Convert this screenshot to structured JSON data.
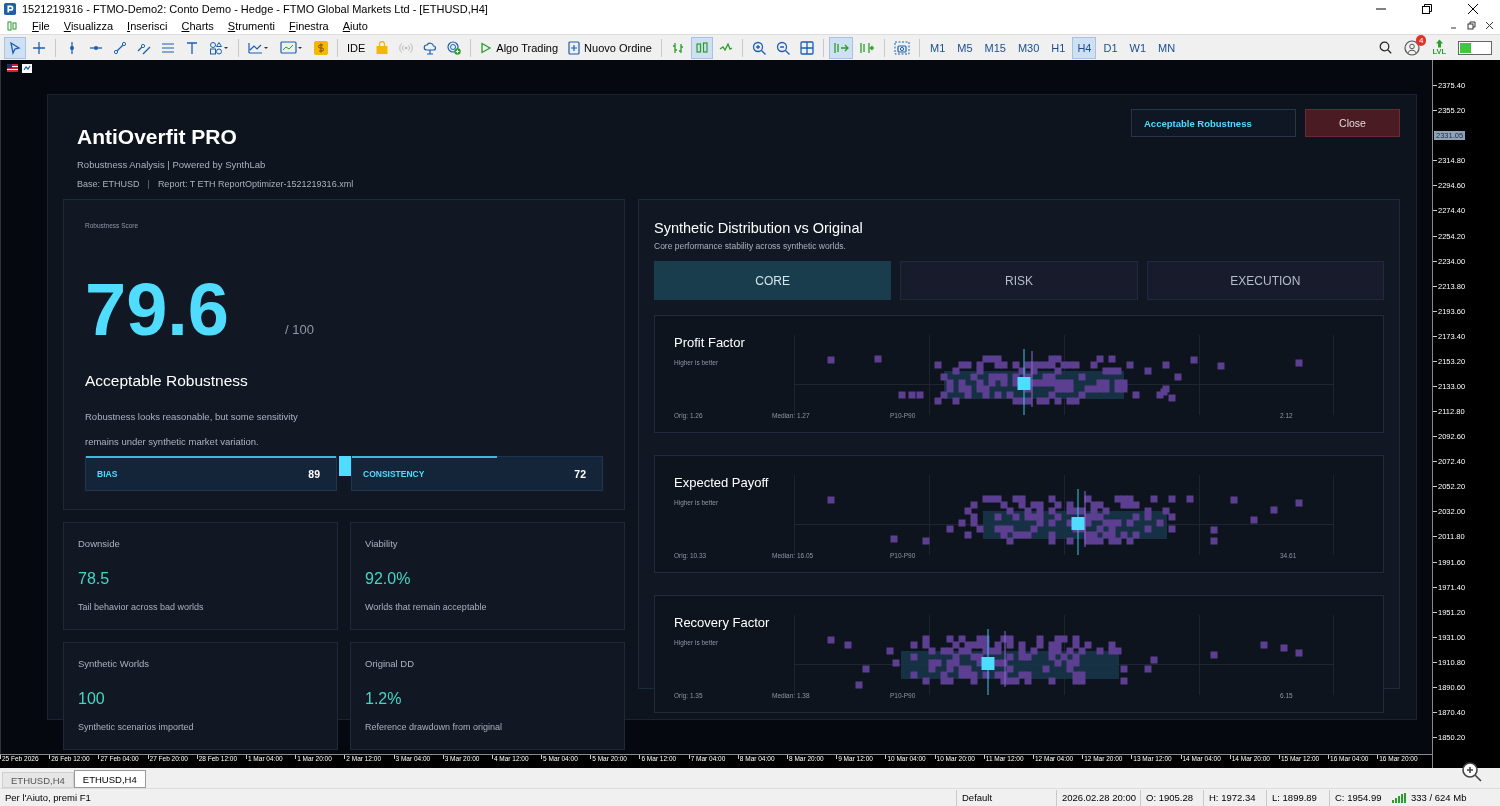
{
  "window": {
    "title": "1521219316 - FTMO-Demo2: Conto Demo - Hedge - FTMO Global Markets Ltd - [ETHUSD,H4]"
  },
  "menu": [
    "File",
    "Visualizza",
    "Inserisci",
    "Charts",
    "Strumenti",
    "Finestra",
    "Aiuto"
  ],
  "toolbar": {
    "groups": [
      [
        {
          "kind": "cursor",
          "selected": true
        },
        {
          "kind": "crosshair",
          "selected": false
        }
      ],
      [
        {
          "kind": "vline",
          "selected": false
        },
        {
          "kind": "hline",
          "selected": false
        },
        {
          "kind": "trend",
          "selected": false
        },
        {
          "kind": "channel",
          "selected": false
        },
        {
          "kind": "lines",
          "selected": false
        },
        {
          "kind": "text",
          "selected": false
        },
        {
          "kind": "shapes",
          "selected": false
        }
      ],
      [
        {
          "kind": "indicators",
          "selected": false
        },
        {
          "kind": "templates",
          "selected": false
        },
        {
          "kind": "market",
          "selected": false
        }
      ],
      [
        {
          "kind": "ide",
          "label": "IDE",
          "selected": false
        },
        {
          "kind": "bag",
          "selected": false
        },
        {
          "kind": "signal",
          "selected": false
        },
        {
          "kind": "cloud",
          "selected": false
        },
        {
          "kind": "vps",
          "selected": false
        }
      ],
      [
        {
          "kind": "algo",
          "label": "Algo Trading",
          "selected": false
        },
        {
          "kind": "order",
          "label": "Nuovo Ordine",
          "selected": false
        }
      ],
      [
        {
          "kind": "bars",
          "selected": false
        },
        {
          "kind": "candles",
          "selected": true
        },
        {
          "kind": "line",
          "selected": false
        }
      ],
      [
        {
          "kind": "zoomin",
          "selected": false
        },
        {
          "kind": "zoomout",
          "selected": false
        },
        {
          "kind": "grid",
          "selected": false
        }
      ],
      [
        {
          "kind": "autoscroll",
          "selected": true
        },
        {
          "kind": "shift",
          "selected": false
        }
      ],
      [
        {
          "kind": "screenshot",
          "selected": false
        }
      ]
    ],
    "timeframes": [
      {
        "label": "M1",
        "selected": false
      },
      {
        "label": "M5",
        "selected": false
      },
      {
        "label": "M15",
        "selected": false
      },
      {
        "label": "M30",
        "selected": false
      },
      {
        "label": "H1",
        "selected": false
      },
      {
        "label": "H4",
        "selected": true
      },
      {
        "label": "D1",
        "selected": false
      },
      {
        "label": "W1",
        "selected": false
      },
      {
        "label": "MN",
        "selected": false
      }
    ],
    "notifications": "4",
    "lvl": "LVL"
  },
  "dialog": {
    "title": "AntiOverfit PRO",
    "subtitle": "Robustness Analysis | Powered by SynthLab",
    "base": "Base: ETHUSD",
    "separator": "|",
    "report": "Report: T ETH ReportOptimizer-1521219316.xml",
    "status_badge": "Acceptable Robustness",
    "close": "Close",
    "score": {
      "label": "Robustness Score",
      "value": "79.6",
      "max": "/ 100",
      "verdict": "Acceptable Robustness",
      "description": "Robustness looks reasonable, but some sensitivity remains under synthetic market variation.",
      "bars": [
        {
          "label": "BIAS",
          "value": "89",
          "level": 1
        },
        {
          "label": "CONSISTENCY",
          "value": "72",
          "level": 0.58
        }
      ]
    },
    "metrics": [
      {
        "label": "Downside",
        "value": "78.5",
        "note": "Tail behavior across bad worlds"
      },
      {
        "label": "Viability",
        "value": "92.0%",
        "note": "Worlds that remain acceptable"
      },
      {
        "label": "Synthetic Worlds",
        "value": "100",
        "note": "Synthetic scenarios imported"
      },
      {
        "label": "Original DD",
        "value": "1.2%",
        "note": "Reference drawdown from original"
      }
    ],
    "distribution": {
      "title": "Synthetic Distribution vs Original",
      "subtitle": "Core performance stability across synthetic worlds.",
      "tabs": [
        {
          "label": "CORE",
          "selected": true
        },
        {
          "label": "RISK",
          "selected": false
        },
        {
          "label": "EXECUTION",
          "selected": false
        }
      ],
      "plots": [
        {
          "title": "Profit Factor",
          "hint": "Higher is better",
          "orig": "Orig: 1.26",
          "median": "Median: 1.27",
          "band": "P10-P90",
          "max": "2.12"
        },
        {
          "title": "Expected Payoff",
          "hint": "Higher is better",
          "orig": "Orig: 10.33",
          "median": "Median: 16.05",
          "band": "P10-P90",
          "max": "34.61"
        },
        {
          "title": "Recovery Factor",
          "hint": "Higher is better",
          "orig": "Orig: 1.35",
          "median": "Median: 1.38",
          "band": "P10-P90",
          "max": "6.15"
        }
      ]
    }
  },
  "price_axis": [
    {
      "text": "2375.40",
      "kind": "tick"
    },
    {
      "text": "2355.20",
      "kind": "tick"
    },
    {
      "text": "2331.05",
      "kind": "current"
    },
    {
      "text": "2314.80",
      "kind": "tick"
    },
    {
      "text": "2294.60",
      "kind": "tick"
    },
    {
      "text": "2274.40",
      "kind": "tick"
    },
    {
      "text": "2254.20",
      "kind": "tick"
    },
    {
      "text": "2234.00",
      "kind": "tick"
    },
    {
      "text": "2213.80",
      "kind": "tick"
    },
    {
      "text": "2193.60",
      "kind": "tick"
    },
    {
      "text": "2173.40",
      "kind": "tick"
    },
    {
      "text": "2153.20",
      "kind": "tick"
    },
    {
      "text": "2133.00",
      "kind": "tick"
    },
    {
      "text": "2112.80",
      "kind": "tick"
    },
    {
      "text": "2092.60",
      "kind": "tick"
    },
    {
      "text": "2072.40",
      "kind": "tick"
    },
    {
      "text": "2052.20",
      "kind": "tick"
    },
    {
      "text": "2032.00",
      "kind": "tick"
    },
    {
      "text": "2011.80",
      "kind": "tick"
    },
    {
      "text": "1991.60",
      "kind": "tick"
    },
    {
      "text": "1971.40",
      "kind": "tick"
    },
    {
      "text": "1951.20",
      "kind": "tick"
    },
    {
      "text": "1931.00",
      "kind": "tick"
    },
    {
      "text": "1910.80",
      "kind": "tick"
    },
    {
      "text": "1890.60",
      "kind": "tick"
    },
    {
      "text": "1870.40",
      "kind": "tick"
    },
    {
      "text": "1850.20",
      "kind": "tick"
    }
  ],
  "time_axis": [
    "25 Feb 2026",
    "26 Feb 12:00",
    "27 Feb 04:00",
    "27 Feb 20:00",
    "28 Feb 12:00",
    "1 Mar 04:00",
    "1 Mar 20:00",
    "2 Mar 12:00",
    "3 Mar 04:00",
    "3 Mar 20:00",
    "4 Mar 12:00",
    "5 Mar 04:00",
    "5 Mar 20:00",
    "6 Mar 12:00",
    "7 Mar 04:00",
    "8 Mar 04:00",
    "8 Mar 20:00",
    "9 Mar 12:00",
    "10 Mar 04:00",
    "10 Mar 20:00",
    "11 Mar 12:00",
    "12 Mar 04:00",
    "12 Mar 20:00",
    "13 Mar 12:00",
    "14 Mar 04:00",
    "14 Mar 20:00",
    "15 Mar 12:00",
    "16 Mar 04:00",
    "16 Mar 20:00"
  ],
  "chart_tabs": [
    {
      "label": "ETHUSD,H4",
      "selected": false
    },
    {
      "label": "ETHUSD,H4",
      "selected": true
    }
  ],
  "status_bar": {
    "help": "Per l'Aiuto, premi F1",
    "profile": "Default",
    "time": "2026.02.28 20:00",
    "open": "O: 1905.28",
    "high": "H: 1972.34",
    "low": "L: 1899.89",
    "close": "C: 1954.99",
    "memory": "333 / 624 Mb"
  }
}
